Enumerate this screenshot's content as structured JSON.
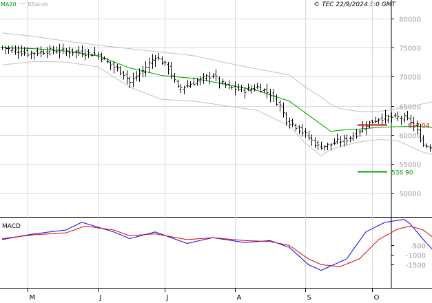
{
  "header": {
    "ma_label": "MA20",
    "bbands_label": "BBands",
    "copyright": "© TEC 22/9/2024 3:0 GMT"
  },
  "colors": {
    "ma": "#00b000",
    "bbands": "#c0c0c0",
    "price": "#000000",
    "macd": "#0000ee",
    "signal": "#dd0000",
    "resistance": "#dd0000",
    "support": "#00a000",
    "grid": "#d8d8d8"
  },
  "chart_data": [
    {
      "type": "line",
      "panel": "price",
      "title": "",
      "legend": [
        "MA20",
        "BBands"
      ],
      "x": [
        "M",
        "J",
        "J",
        "A",
        "S",
        "O"
      ],
      "yticks": [
        50000,
        55000,
        60000,
        65000,
        70000,
        75000,
        80000
      ],
      "ytick_labels": [
        "50000",
        "55000",
        "60000",
        "65000",
        "70000",
        "75000",
        "80000"
      ],
      "ylim": [
        46500,
        81500
      ],
      "levels": [
        {
          "name": "resistance",
          "value": 61704,
          "label": "617 04"
        },
        {
          "name": "support",
          "value": 53690,
          "label": "536 90"
        }
      ],
      "bars_per_month": [
        22,
        21,
        22,
        22,
        21,
        12
      ],
      "price_path": [
        [
          0,
          75000
        ],
        [
          8,
          74000
        ],
        [
          16,
          74500
        ],
        [
          24,
          74200
        ],
        [
          30,
          73800
        ],
        [
          34,
          72000
        ],
        [
          38,
          70500
        ],
        [
          40,
          69000
        ],
        [
          44,
          71000
        ],
        [
          48,
          73500
        ],
        [
          52,
          71500
        ],
        [
          55,
          68000
        ],
        [
          58,
          68500
        ],
        [
          62,
          69500
        ],
        [
          66,
          70300
        ],
        [
          68,
          69000
        ],
        [
          72,
          68000
        ],
        [
          76,
          67700
        ],
        [
          80,
          68200
        ],
        [
          84,
          67000
        ],
        [
          87,
          65000
        ],
        [
          89,
          62500
        ],
        [
          92,
          61500
        ],
        [
          95,
          60000
        ],
        [
          99,
          58000
        ],
        [
          102,
          58200
        ],
        [
          105,
          58800
        ],
        [
          108,
          59300
        ],
        [
          111,
          60200
        ],
        [
          114,
          61800
        ],
        [
          118,
          62800
        ],
        [
          122,
          63000
        ],
        [
          126,
          62900
        ],
        [
          128,
          62300
        ],
        [
          130,
          60600
        ],
        [
          132,
          58300
        ],
        [
          136,
          57800
        ],
        [
          140,
          57500
        ],
        [
          142,
          57200
        ],
        [
          144,
          58000
        ],
        [
          145,
          56600
        ]
      ],
      "series": [
        {
          "name": "MA20",
          "path": [
            [
              0,
              75000
            ],
            [
              10,
              74800
            ],
            [
              20,
              74400
            ],
            [
              30,
              73600
            ],
            [
              40,
              71500
            ],
            [
              50,
              70200
            ],
            [
              60,
              69700
            ],
            [
              70,
              68700
            ],
            [
              80,
              67600
            ],
            [
              90,
              65800
            ],
            [
              100,
              61800
            ],
            [
              103,
              60600
            ],
            [
              106,
              60800
            ],
            [
              112,
              61000
            ],
            [
              118,
              61300
            ],
            [
              124,
              61400
            ],
            [
              130,
              61500
            ],
            [
              136,
              61200
            ],
            [
              141,
              60500
            ],
            [
              145,
              59700
            ]
          ]
        },
        {
          "name": "BBands upper",
          "path": [
            [
              0,
              77500
            ],
            [
              10,
              76900
            ],
            [
              20,
              76100
            ],
            [
              30,
              75400
            ],
            [
              40,
              74800
            ],
            [
              50,
              74200
            ],
            [
              60,
              73600
            ],
            [
              70,
              72400
            ],
            [
              80,
              71300
            ],
            [
              90,
              70300
            ],
            [
              95,
              68200
            ],
            [
              100,
              66500
            ],
            [
              103,
              65200
            ],
            [
              106,
              64500
            ],
            [
              112,
              64000
            ],
            [
              118,
              64000
            ],
            [
              124,
              64500
            ],
            [
              130,
              65100
            ],
            [
              136,
              65800
            ],
            [
              142,
              65600
            ],
            [
              145,
              64900
            ]
          ]
        },
        {
          "name": "BBands lower",
          "path": [
            [
              0,
              72000
            ],
            [
              10,
              72600
            ],
            [
              20,
              72500
            ],
            [
              30,
              71700
            ],
            [
              40,
              68200
            ],
            [
              50,
              66100
            ],
            [
              60,
              65800
            ],
            [
              70,
              65000
            ],
            [
              80,
              64200
            ],
            [
              90,
              61500
            ],
            [
              95,
              58600
            ],
            [
              100,
              56400
            ],
            [
              103,
              57500
            ],
            [
              106,
              58000
            ],
            [
              112,
              58800
            ],
            [
              118,
              59200
            ],
            [
              124,
              59000
            ],
            [
              128,
              58000
            ],
            [
              132,
              57000
            ],
            [
              136,
              56500
            ],
            [
              141,
              55100
            ],
            [
              145,
              54300
            ]
          ]
        }
      ]
    },
    {
      "type": "line",
      "panel": "indicator",
      "title": "MACD",
      "yticks": [
        -500,
        -1000,
        -1500
      ],
      "ytick_labels": [
        "-500",
        "-1000",
        "-1500"
      ],
      "ylim": [
        -2600,
        800
      ],
      "series": [
        {
          "name": "MACD",
          "path": [
            [
              0,
              -200
            ],
            [
              10,
              100
            ],
            [
              20,
              300
            ],
            [
              25,
              700
            ],
            [
              35,
              200
            ],
            [
              40,
              -150
            ],
            [
              48,
              200
            ],
            [
              58,
              -400
            ],
            [
              66,
              -100
            ],
            [
              76,
              -350
            ],
            [
              84,
              -250
            ],
            [
              90,
              -600
            ],
            [
              96,
              -1500
            ],
            [
              100,
              -1800
            ],
            [
              108,
              -1200
            ],
            [
              114,
              200
            ],
            [
              120,
              700
            ],
            [
              126,
              850
            ],
            [
              128,
              600
            ],
            [
              132,
              -200
            ],
            [
              136,
              -900
            ],
            [
              140,
              -1000
            ],
            [
              144,
              -950
            ],
            [
              145,
              -1000
            ]
          ]
        },
        {
          "name": "Signal",
          "path": [
            [
              0,
              -150
            ],
            [
              10,
              50
            ],
            [
              20,
              150
            ],
            [
              26,
              500
            ],
            [
              35,
              300
            ],
            [
              40,
              0
            ],
            [
              48,
              100
            ],
            [
              58,
              -200
            ],
            [
              66,
              -100
            ],
            [
              76,
              -250
            ],
            [
              84,
              -300
            ],
            [
              90,
              -500
            ],
            [
              96,
              -1200
            ],
            [
              100,
              -1500
            ],
            [
              106,
              -1600
            ],
            [
              112,
              -1200
            ],
            [
              118,
              -200
            ],
            [
              124,
              350
            ],
            [
              128,
              500
            ],
            [
              132,
              300
            ],
            [
              136,
              -200
            ],
            [
              140,
              -700
            ],
            [
              143,
              -900
            ],
            [
              145,
              -950
            ]
          ]
        }
      ]
    }
  ]
}
